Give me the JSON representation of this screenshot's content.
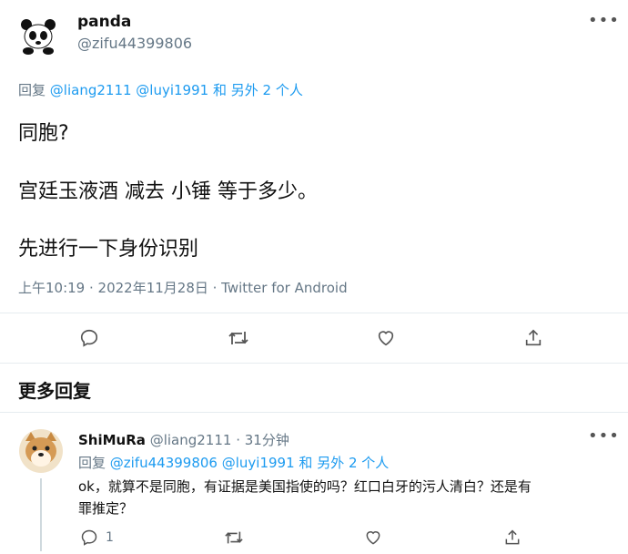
{
  "main_tweet": {
    "author_name": "panda",
    "author_handle": "@zifu44399806",
    "reply_to": {
      "prefix": "回复",
      "users": "@liang2111 @luyi1991",
      "suffix": "和 另外 2 个人"
    },
    "lines": [
      "同胞?",
      "宫廷玉液酒 减去 小锤 等于多少。",
      "先进行一下身份识别"
    ],
    "meta": "上午10:19 · 2022年11月28日 · Twitter for Android"
  },
  "more_replies_heading": "更多回复",
  "reply_tweet": {
    "author_name": "ShiMuRa",
    "author_handle": "@liang2111",
    "time": "· 31分钟",
    "reply_to": {
      "prefix": "回复",
      "users": "@zifu44399806 @luyi1991",
      "suffix": "和 另外 2 个人"
    },
    "text_line1": "ok，就算不是同胞，有证据是美国指使的吗？红口白牙的污人清白？还是有",
    "text_line2": "罪推定？",
    "reply_count": "1"
  },
  "colors": {
    "link": "#1d9bf0",
    "muted": "#657786"
  }
}
